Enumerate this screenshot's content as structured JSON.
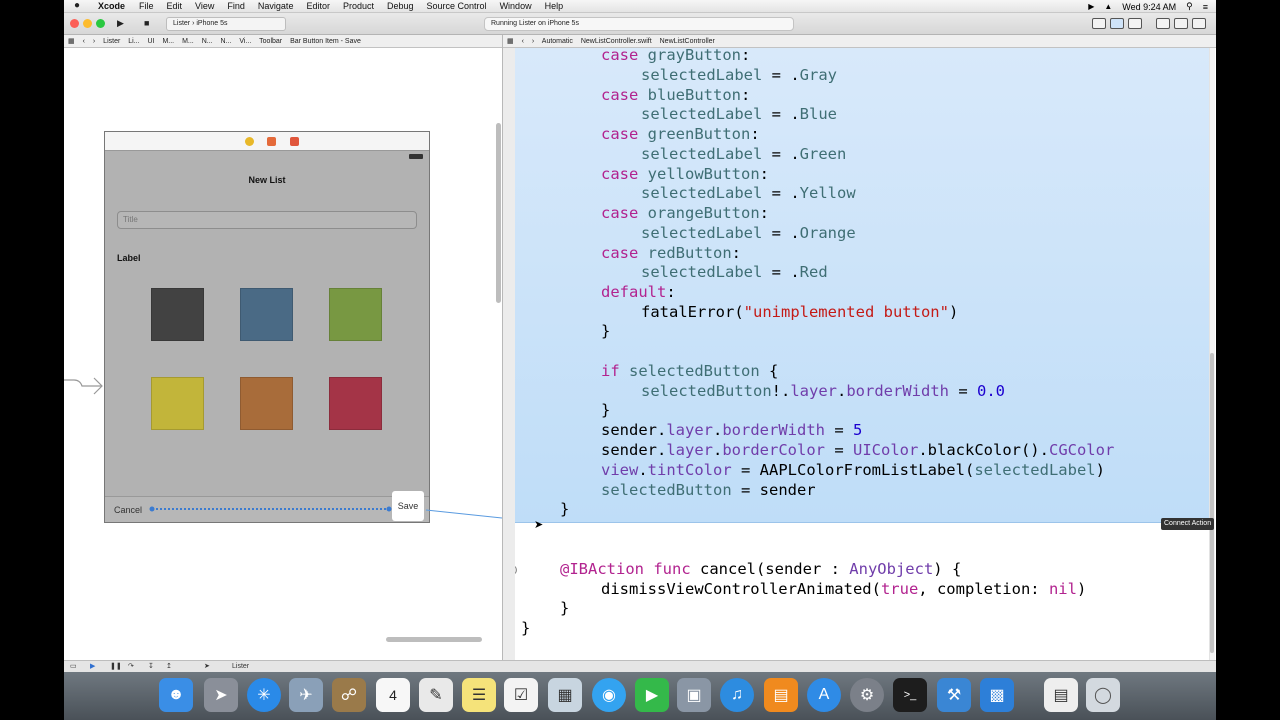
{
  "menubar": {
    "app_name": "Xcode",
    "items": [
      "File",
      "Edit",
      "View",
      "Find",
      "Navigate",
      "Editor",
      "Product",
      "Debug",
      "Source Control",
      "Window",
      "Help"
    ],
    "clock": "Wed 9:24 AM"
  },
  "toolbar": {
    "scheme": "Lister",
    "destination": "iPhone 5s",
    "activity": "Running Lister on iPhone 5s"
  },
  "jumpbar_left": [
    "Lister",
    "Li...",
    "UI",
    "M...",
    "M...",
    "N...",
    "N...",
    "Vi...",
    "Toolbar",
    "Bar Button Item - Save"
  ],
  "jumpbar_right": [
    "Automatic",
    "NewListController.swift",
    "NewListController"
  ],
  "storyboard": {
    "vc_title": "New List",
    "title_placeholder": "Title",
    "label": "Label",
    "cancel": "Cancel",
    "save": "Save",
    "swatches": [
      {
        "name": "gray",
        "color": "#424242"
      },
      {
        "name": "blue",
        "color": "#4a6a85"
      },
      {
        "name": "green",
        "color": "#789842"
      },
      {
        "name": "yellow",
        "color": "#c2b53a"
      },
      {
        "name": "orange",
        "color": "#a86c3a"
      },
      {
        "name": "red",
        "color": "#a43447"
      }
    ]
  },
  "connect_tooltip": "Connect Action",
  "debugbar": {
    "target": "Lister"
  }
}
